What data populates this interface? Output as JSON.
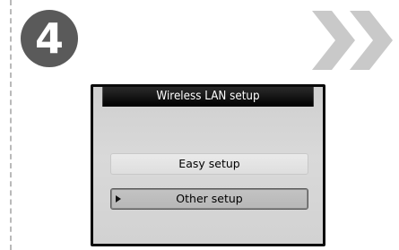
{
  "step": {
    "number": "4"
  },
  "icons": {
    "next": "double-chevron-right-icon",
    "cursor": "triangle-right-icon"
  },
  "screen": {
    "title": "Wireless LAN setup",
    "menu_items": [
      {
        "label": "Easy setup",
        "selected": false
      },
      {
        "label": "Other setup",
        "selected": true
      }
    ]
  },
  "colors": {
    "step_circle": "#5a5a5a",
    "arrows": "#c9c9c9",
    "title_bar": "#000000",
    "screen_bg": "#d6d6d6"
  }
}
